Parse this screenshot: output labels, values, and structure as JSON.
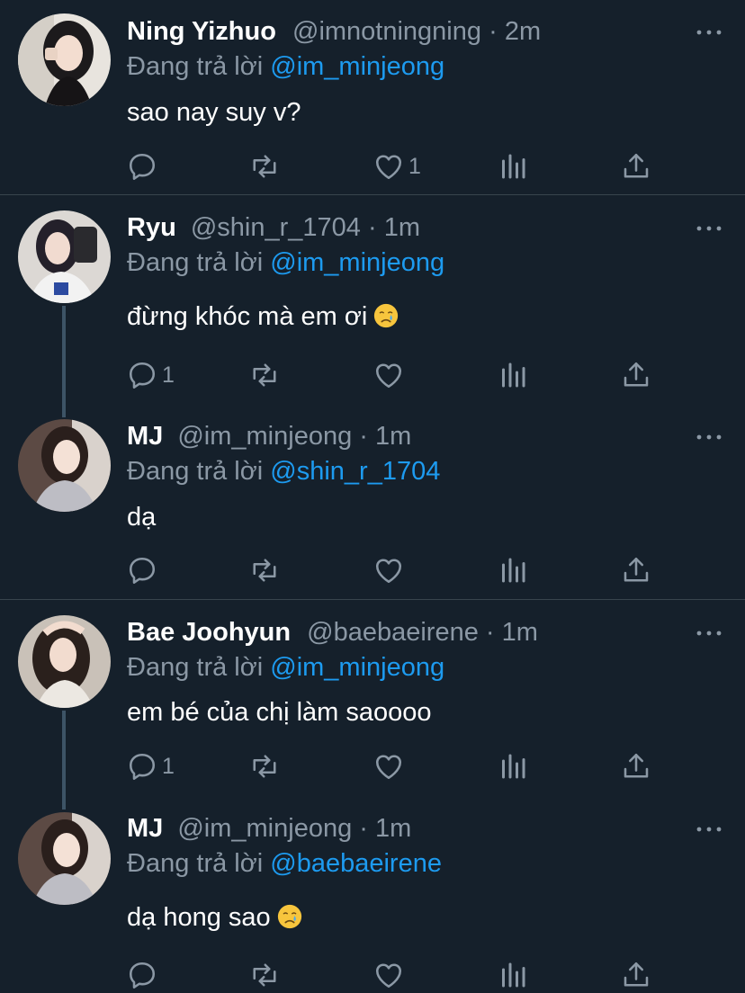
{
  "colors": {
    "background": "#15202b",
    "text": "#ffffff",
    "muted": "#8b98a5",
    "mention": "#1d9bf0",
    "divider": "#38444d"
  },
  "reply_prefix": "Đang trả lời",
  "icons": [
    "reply-icon",
    "retweet-icon",
    "like-icon",
    "views-icon",
    "share-icon",
    "more-icon",
    "crying-face-icon"
  ],
  "tweets": [
    {
      "name": "Ning Yizhuo",
      "handle": "@imnotningning",
      "sep": "·",
      "time": "2m",
      "reply_to": "@im_minjeong",
      "text": "sao nay suy v?",
      "replies": "",
      "likes": "1"
    },
    {
      "name": "Ryu",
      "handle": "@shin_r_1704",
      "sep": "·",
      "time": "1m",
      "reply_to": "@im_minjeong",
      "text": "đừng khóc mà em ơi",
      "replies": "1",
      "likes": ""
    },
    {
      "name": "MJ",
      "handle": "@im_minjeong",
      "sep": "·",
      "time": "1m",
      "reply_to": "@shin_r_1704",
      "text": "dạ",
      "replies": "",
      "likes": ""
    },
    {
      "name": "Bae Joohyun",
      "handle": "@baebaeirene",
      "sep": "·",
      "time": "1m",
      "reply_to": "@im_minjeong",
      "text": "em bé của chị làm saoooo",
      "replies": "1",
      "likes": ""
    },
    {
      "name": "MJ",
      "handle": "@im_minjeong",
      "sep": "·",
      "time": "1m",
      "reply_to": "@baebaeirene",
      "text": "dạ hong sao",
      "replies": "",
      "likes": ""
    }
  ]
}
